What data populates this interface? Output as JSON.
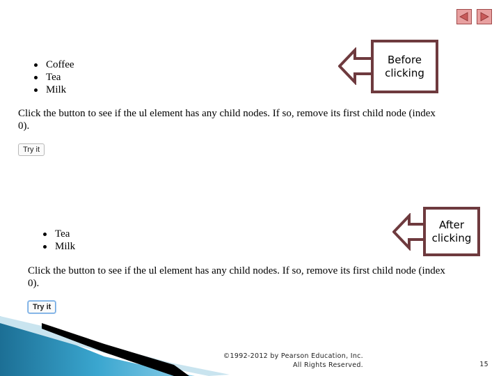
{
  "nav": {
    "prev_icon": "triangle-left-icon",
    "next_icon": "triangle-right-icon"
  },
  "before": {
    "list": [
      "Coffee",
      "Tea",
      "Milk"
    ],
    "paragraph": "Click the button to see if the ul element has any child nodes. If so, remove its first child node (index 0).",
    "button_label": "Try it",
    "callout": [
      "Before",
      "clicking"
    ]
  },
  "after": {
    "list": [
      "Tea",
      "Milk"
    ],
    "paragraph": "Click the button to see if the ul element has any child nodes. If so, remove its first child node (index 0).",
    "button_label": "Try it",
    "callout": [
      "After",
      "clicking"
    ]
  },
  "footer": {
    "copyright": "©1992-2012 by Pearson Education, Inc.",
    "rights": "All Rights Reserved.",
    "page_number": "15"
  },
  "colors": {
    "callout_border": "#6e3a3e",
    "nav_fill": "#e8a0a0",
    "wave_blue": "#2a8fb8"
  }
}
